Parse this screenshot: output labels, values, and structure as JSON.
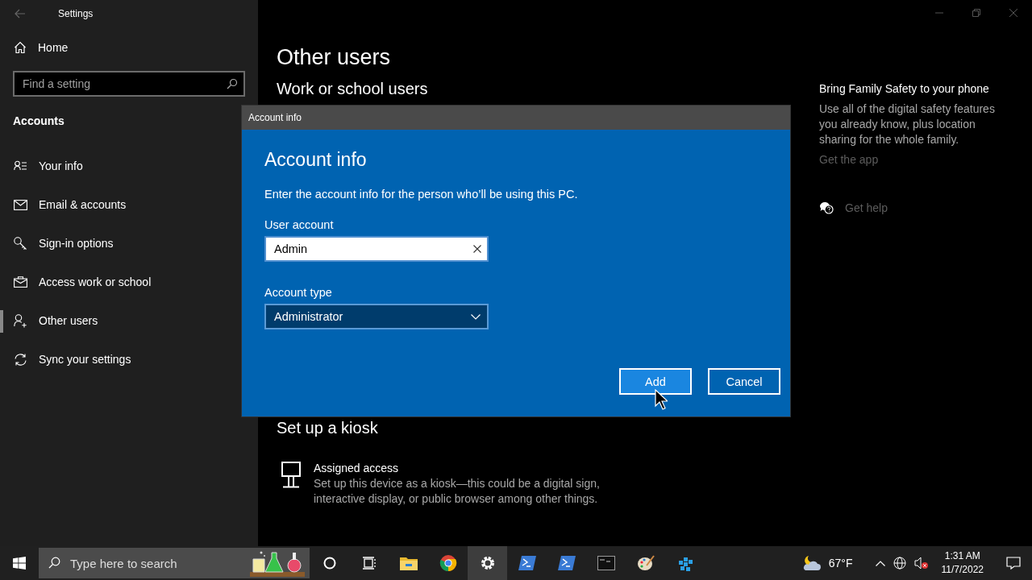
{
  "window": {
    "title": "Settings"
  },
  "sidebar": {
    "home": "Home",
    "search": {
      "placeholder": "Find a setting"
    },
    "section": "Accounts",
    "items": [
      {
        "kind": "info",
        "label": "Your info",
        "selected": false
      },
      {
        "kind": "email",
        "label": "Email & accounts",
        "selected": false
      },
      {
        "kind": "key",
        "label": "Sign-in options",
        "selected": false
      },
      {
        "kind": "briefcase",
        "label": "Access work or school",
        "selected": false
      },
      {
        "kind": "person",
        "label": "Other users",
        "selected": true
      },
      {
        "kind": "sync",
        "label": "Sync your settings",
        "selected": false
      }
    ]
  },
  "main": {
    "title": "Other users",
    "section": "Work or school users",
    "kiosk": {
      "title": "Set up a kiosk",
      "item_title": "Assigned access",
      "item_description": "Set up this device as a kiosk—this could be a digital sign, interactive display, or public browser among other things."
    }
  },
  "aside": {
    "title": "Bring Family Safety to your phone",
    "text": "Use all of the digital safety features you already know, plus location sharing for the whole family.",
    "link": "Get the app",
    "help": "Get help"
  },
  "dialog": {
    "caption": "Account info",
    "heading": "Account info",
    "instruction": "Enter the account info for the person who’ll be using this PC.",
    "user_field": {
      "label": "User account",
      "value": "Admin"
    },
    "type_field": {
      "label": "Account type",
      "value": "Administrator"
    },
    "buttons": [
      {
        "kind": "primary",
        "label": "Add"
      },
      {
        "kind": "secondary",
        "label": "Cancel"
      }
    ]
  },
  "taskbar": {
    "search": {
      "placeholder": "Type here to search"
    },
    "apps": [
      {
        "kind": "cortana",
        "selected": false
      },
      {
        "kind": "taskview",
        "selected": false
      },
      {
        "kind": "explorer",
        "selected": false
      },
      {
        "kind": "chrome",
        "selected": false
      },
      {
        "kind": "settings",
        "selected": true
      },
      {
        "kind": "powershell",
        "selected": false
      },
      {
        "kind": "powershell",
        "selected": false
      },
      {
        "kind": "terminal",
        "selected": false
      },
      {
        "kind": "paint",
        "selected": false
      },
      {
        "kind": "cubes",
        "selected": false
      }
    ],
    "temperature": "67°F",
    "time": "1:31 AM",
    "date": "11/7/2022"
  }
}
